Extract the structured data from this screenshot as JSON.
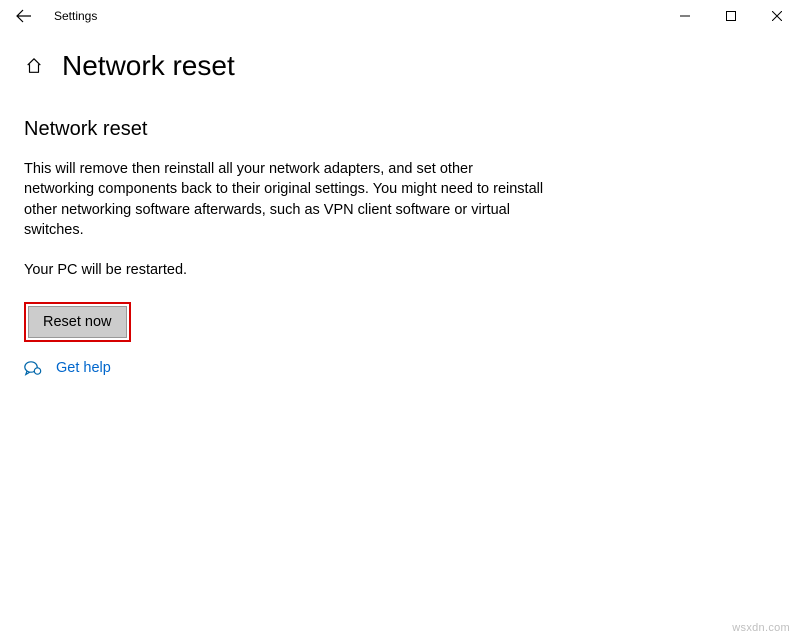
{
  "titlebar": {
    "app_title": "Settings"
  },
  "header": {
    "page_title": "Network reset"
  },
  "content": {
    "section_title": "Network reset",
    "description": "This will remove then reinstall all your network adapters, and set other networking components back to their original settings. You might need to reinstall other networking software afterwards, such as VPN client software or virtual switches.",
    "restart_note": "Your PC will be restarted.",
    "reset_button_label": "Reset now",
    "get_help_label": "Get help"
  },
  "watermark": "wsxdn.com"
}
